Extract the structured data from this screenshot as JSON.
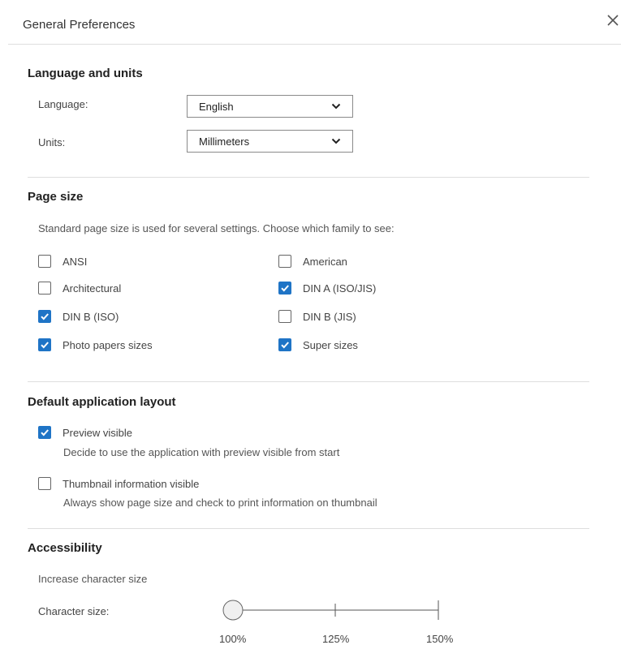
{
  "dialog": {
    "title": "General Preferences",
    "close_icon": "close-icon"
  },
  "language_units": {
    "title": "Language and units",
    "language_label": "Language:",
    "language_value": "English",
    "units_label": "Units:",
    "units_value": "Millimeters"
  },
  "page_size": {
    "title": "Page size",
    "description": "Standard page size is used for several settings. Choose which family to see:",
    "options": [
      {
        "label": "ANSI",
        "checked": false
      },
      {
        "label": "American",
        "checked": false
      },
      {
        "label": "Architectural",
        "checked": false
      },
      {
        "label": "DIN A (ISO/JIS)",
        "checked": true
      },
      {
        "label": "DIN B (ISO)",
        "checked": true
      },
      {
        "label": "DIN B (JIS)",
        "checked": false
      },
      {
        "label": "Photo papers sizes",
        "checked": true
      },
      {
        "label": "Super sizes",
        "checked": true
      }
    ]
  },
  "layout": {
    "title": "Default application layout",
    "preview": {
      "label": "Preview visible",
      "checked": true,
      "description": "Decide to use the application with preview visible from start"
    },
    "thumbnail": {
      "label": "Thumbnail information visible",
      "checked": false,
      "description": "Always show page size and check to print information on thumbnail"
    }
  },
  "accessibility": {
    "title": "Accessibility",
    "subtitle": "Increase character size",
    "character_size_label": "Character size:",
    "ticks": [
      "100%",
      "125%",
      "150%"
    ],
    "selected": "100%"
  },
  "colors": {
    "accent": "#1f74c6",
    "divider": "#dedede"
  }
}
